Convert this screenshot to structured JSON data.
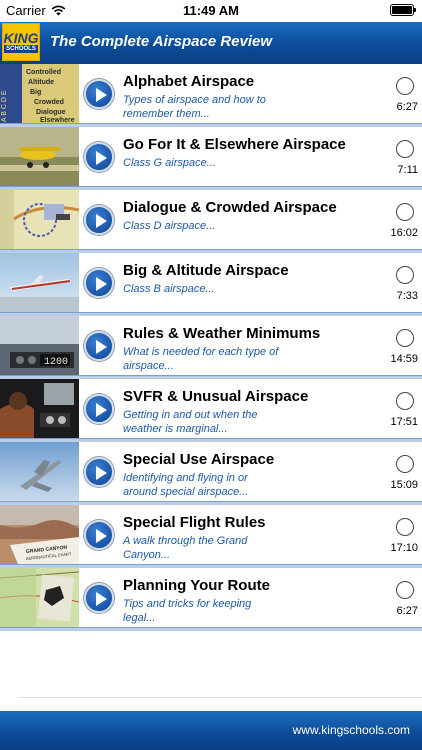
{
  "status_bar": {
    "carrier": "Carrier",
    "time": "11:49 AM"
  },
  "header": {
    "logo_top": "KING",
    "logo_bottom": "SCHOOLS",
    "title": "The Complete Airspace Review"
  },
  "lessons": [
    {
      "title": "Alphabet Airspace",
      "desc": "Types of airspace and how to remember them...",
      "duration": "6:27"
    },
    {
      "title": "Go For It & Elsewhere Airspace",
      "desc": "Class G airspace...",
      "duration": "7:11"
    },
    {
      "title": "Dialogue & Crowded Airspace",
      "desc": "Class D airspace...",
      "duration": "16:02"
    },
    {
      "title": "Big & Altitude Airspace",
      "desc": "Class B airspace...",
      "duration": "7:33"
    },
    {
      "title": "Rules & Weather Minimums",
      "desc": "What is needed for each type of airspace...",
      "duration": "14:59"
    },
    {
      "title": "SVFR & Unusual Airspace",
      "desc": "Getting in and out when the weather is marginal...",
      "duration": "17:51"
    },
    {
      "title": "Special Use Airspace",
      "desc": "Identifying and flying in or around special airspace...",
      "duration": "15:09"
    },
    {
      "title": "Special Flight Rules",
      "desc": "A walk through the Grand Canyon...",
      "duration": "17:10"
    },
    {
      "title": "Planning Your Route",
      "desc": "Tips and tricks for keeping legal...",
      "duration": "6:27"
    }
  ],
  "thumb_text": {
    "alpha_letters": "A B C D E",
    "alpha_words": "Controlled Altitude Big Crowded Dialogue Elsewhere",
    "transponder": "1200",
    "canyon_line1": "GRAND CANYON",
    "canyon_line2": "AERONAUTICAL CHART"
  },
  "footer": {
    "url": "www.kingschools.com"
  }
}
